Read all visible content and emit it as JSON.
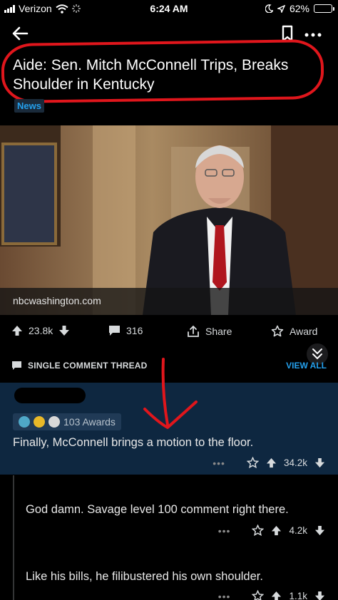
{
  "status_bar": {
    "carrier": "Verizon",
    "time": "6:24 AM",
    "battery_percent": "62%",
    "battery_level": 0.62
  },
  "post": {
    "title": "Aide: Sen. Mitch McConnell Trips, Breaks Shoulder in Kentucky",
    "flair": "News",
    "link_domain": "nbcwashington.com",
    "upvotes": "23.8k",
    "comments": "316",
    "share_label": "Share",
    "award_label": "Award"
  },
  "thread": {
    "label": "SINGLE COMMENT THREAD",
    "view_all": "VIEW ALL"
  },
  "comments": [
    {
      "awards": "103 Awards",
      "text": "Finally, McConnell brings a motion to the floor.",
      "score": "34.2k"
    },
    {
      "text": "God damn. Savage level 100 comment right there.",
      "score": "4.2k"
    },
    {
      "text": "Like his bills, he filibustered his own shoulder.",
      "score": "1.1k"
    }
  ],
  "colors": {
    "accent_blue": "#24a0ed",
    "highlight_bg": "#0e2740",
    "annotation_red": "#e0161c"
  }
}
